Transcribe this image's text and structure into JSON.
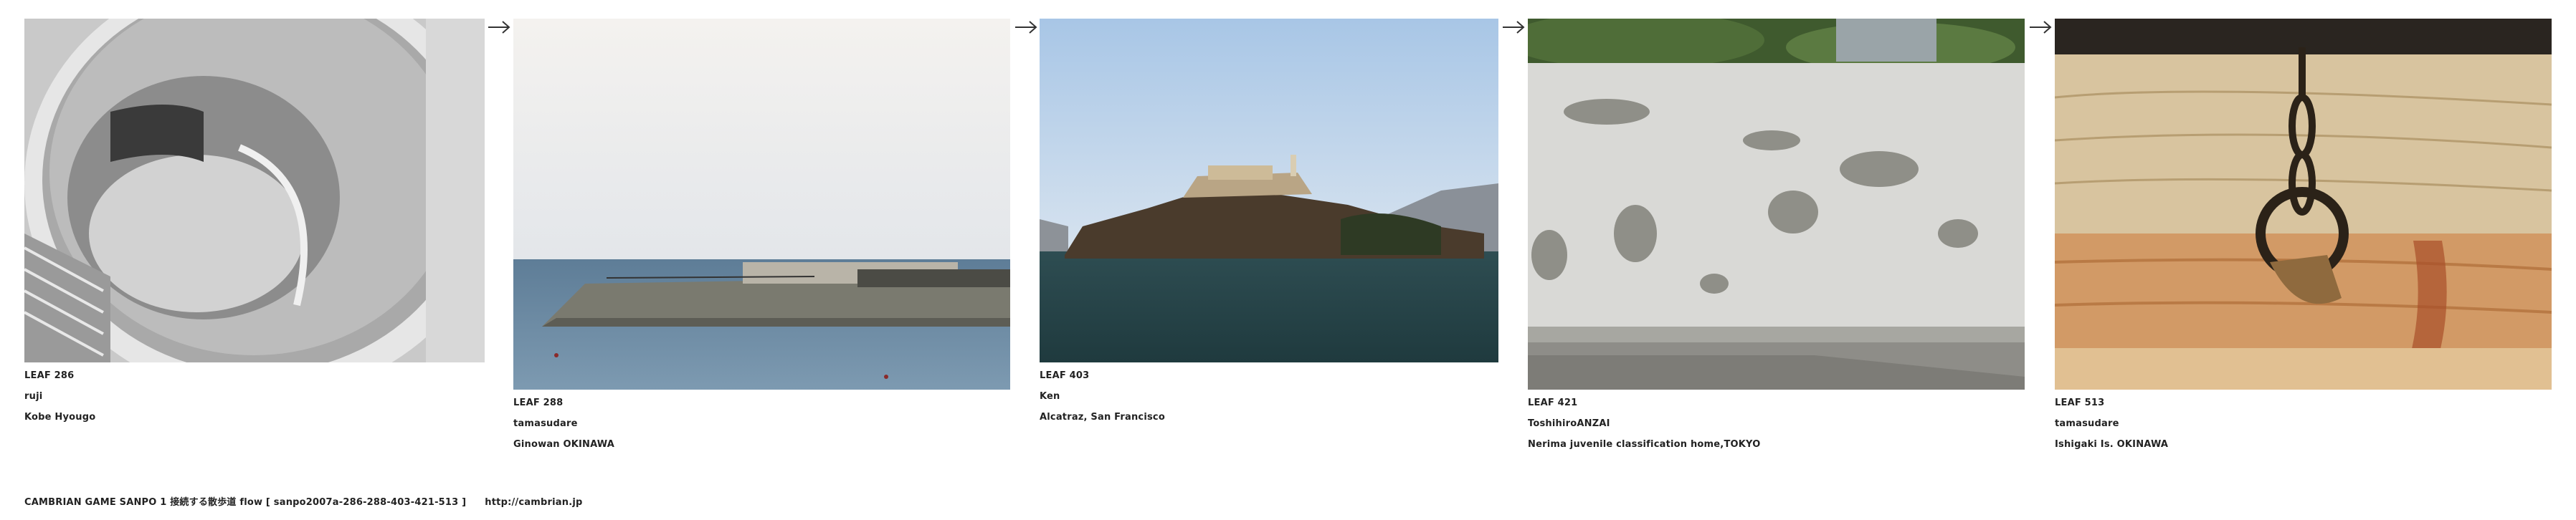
{
  "leaves": [
    {
      "id": "LEAF 286",
      "author": "ruji",
      "location": "Kobe Hyougo",
      "photo_subject": "spiral concrete staircase"
    },
    {
      "id": "LEAF 288",
      "author": "tamasudare",
      "location": "Ginowan OKINAWA",
      "photo_subject": "breakwater and sea"
    },
    {
      "id": "LEAF 403",
      "author": "Ken",
      "location": "Alcatraz, San Francisco",
      "photo_subject": "Alcatraz island"
    },
    {
      "id": "LEAF 421",
      "author": "ToshihiroANZAI",
      "location": "Nerima juvenile classification home,TOKYO",
      "photo_subject": "patched concrete wall"
    },
    {
      "id": "LEAF 513",
      "author": "tamasudare",
      "location": "Ishigaki Is. OKINAWA",
      "photo_subject": "iron ring on chain"
    }
  ],
  "arrow_icon": "arrow-right-icon",
  "footer": {
    "text": "CAMBRIAN GAME  SANPO 1 接続する散歩道 flow [ sanpo2007a-286-288-403-421-513 ]",
    "url": "http://cambrian.jp"
  }
}
